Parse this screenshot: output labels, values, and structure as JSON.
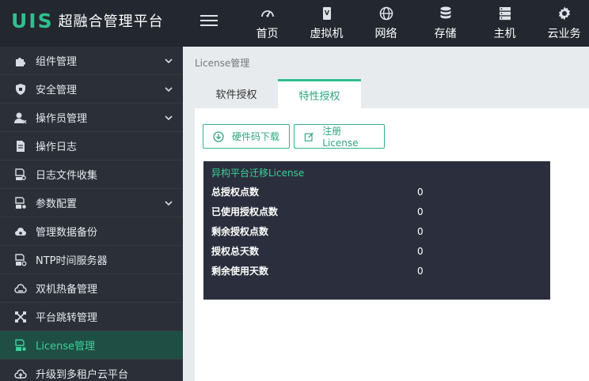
{
  "brand": {
    "logo": "UIS",
    "name": "超融合管理平台"
  },
  "colors": {
    "accent": "#2fbf8f",
    "topbar": "#23272f",
    "sidebar": "#2b3038",
    "active_bg": "#1f4e44",
    "info_box": "#2b2f3d"
  },
  "topnav": [
    {
      "label": "首页",
      "icon": "dashboard-icon"
    },
    {
      "label": "虚拟机",
      "icon": "vm-icon"
    },
    {
      "label": "网络",
      "icon": "globe-icon"
    },
    {
      "label": "存储",
      "icon": "database-icon"
    },
    {
      "label": "主机",
      "icon": "server-icon"
    },
    {
      "label": "云业务",
      "icon": "gear-icon"
    }
  ],
  "sidebar": {
    "items": [
      {
        "label": "组件管理",
        "icon": "puzzle-icon",
        "expandable": true
      },
      {
        "label": "安全管理",
        "icon": "shield-icon",
        "expandable": true
      },
      {
        "label": "操作员管理",
        "icon": "user-icon",
        "expandable": true
      },
      {
        "label": "操作日志",
        "icon": "document-icon",
        "expandable": false
      },
      {
        "label": "日志文件收集",
        "icon": "file-search-icon",
        "expandable": false
      },
      {
        "label": "参数配置",
        "icon": "config-icon",
        "expandable": true
      },
      {
        "label": "管理数据备份",
        "icon": "cloud-backup-icon",
        "expandable": false
      },
      {
        "label": "NTP时间服务器",
        "icon": "clock-doc-icon",
        "expandable": false
      },
      {
        "label": "双机热备管理",
        "icon": "cloud-sync-icon",
        "expandable": false
      },
      {
        "label": "平台跳转管理",
        "icon": "cross-arrows-icon",
        "expandable": false
      },
      {
        "label": "License管理",
        "icon": "license-icon",
        "expandable": false,
        "active": true
      },
      {
        "label": "升级到多租户云平台",
        "icon": "cloud-upload-icon",
        "expandable": false
      }
    ]
  },
  "breadcrumb": "License管理",
  "tabs": [
    {
      "label": "软件授权",
      "active": false
    },
    {
      "label": "特性授权",
      "active": true
    }
  ],
  "buttons": {
    "download": "硬件码下载",
    "register": "注册License"
  },
  "license_info": {
    "title": "异构平台迁移License",
    "rows": [
      {
        "key": "总授权点数",
        "value": "0"
      },
      {
        "key": "已使用授权点数",
        "value": "0"
      },
      {
        "key": "剩余授权点数",
        "value": "0"
      },
      {
        "key": "授权总天数",
        "value": "0"
      },
      {
        "key": "剩余使用天数",
        "value": "0"
      }
    ]
  }
}
